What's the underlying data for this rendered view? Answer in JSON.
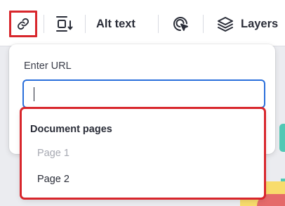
{
  "toolbar": {
    "alt_text_label": "Alt text",
    "layers_label": "Layers",
    "icons": [
      "link-icon",
      "spacing-icon",
      "animate-icon",
      "layers-icon"
    ]
  },
  "link_popover": {
    "label": "Enter URL",
    "input_value": "",
    "input_placeholder": ""
  },
  "dropdown": {
    "heading": "Document pages",
    "items": [
      {
        "label": "Page 1",
        "disabled": true
      },
      {
        "label": "Page 2",
        "disabled": false
      }
    ]
  },
  "colors": {
    "highlight": "#d8262c",
    "focus": "#2a6fdb",
    "canvas_bg": "#ebecf0"
  }
}
